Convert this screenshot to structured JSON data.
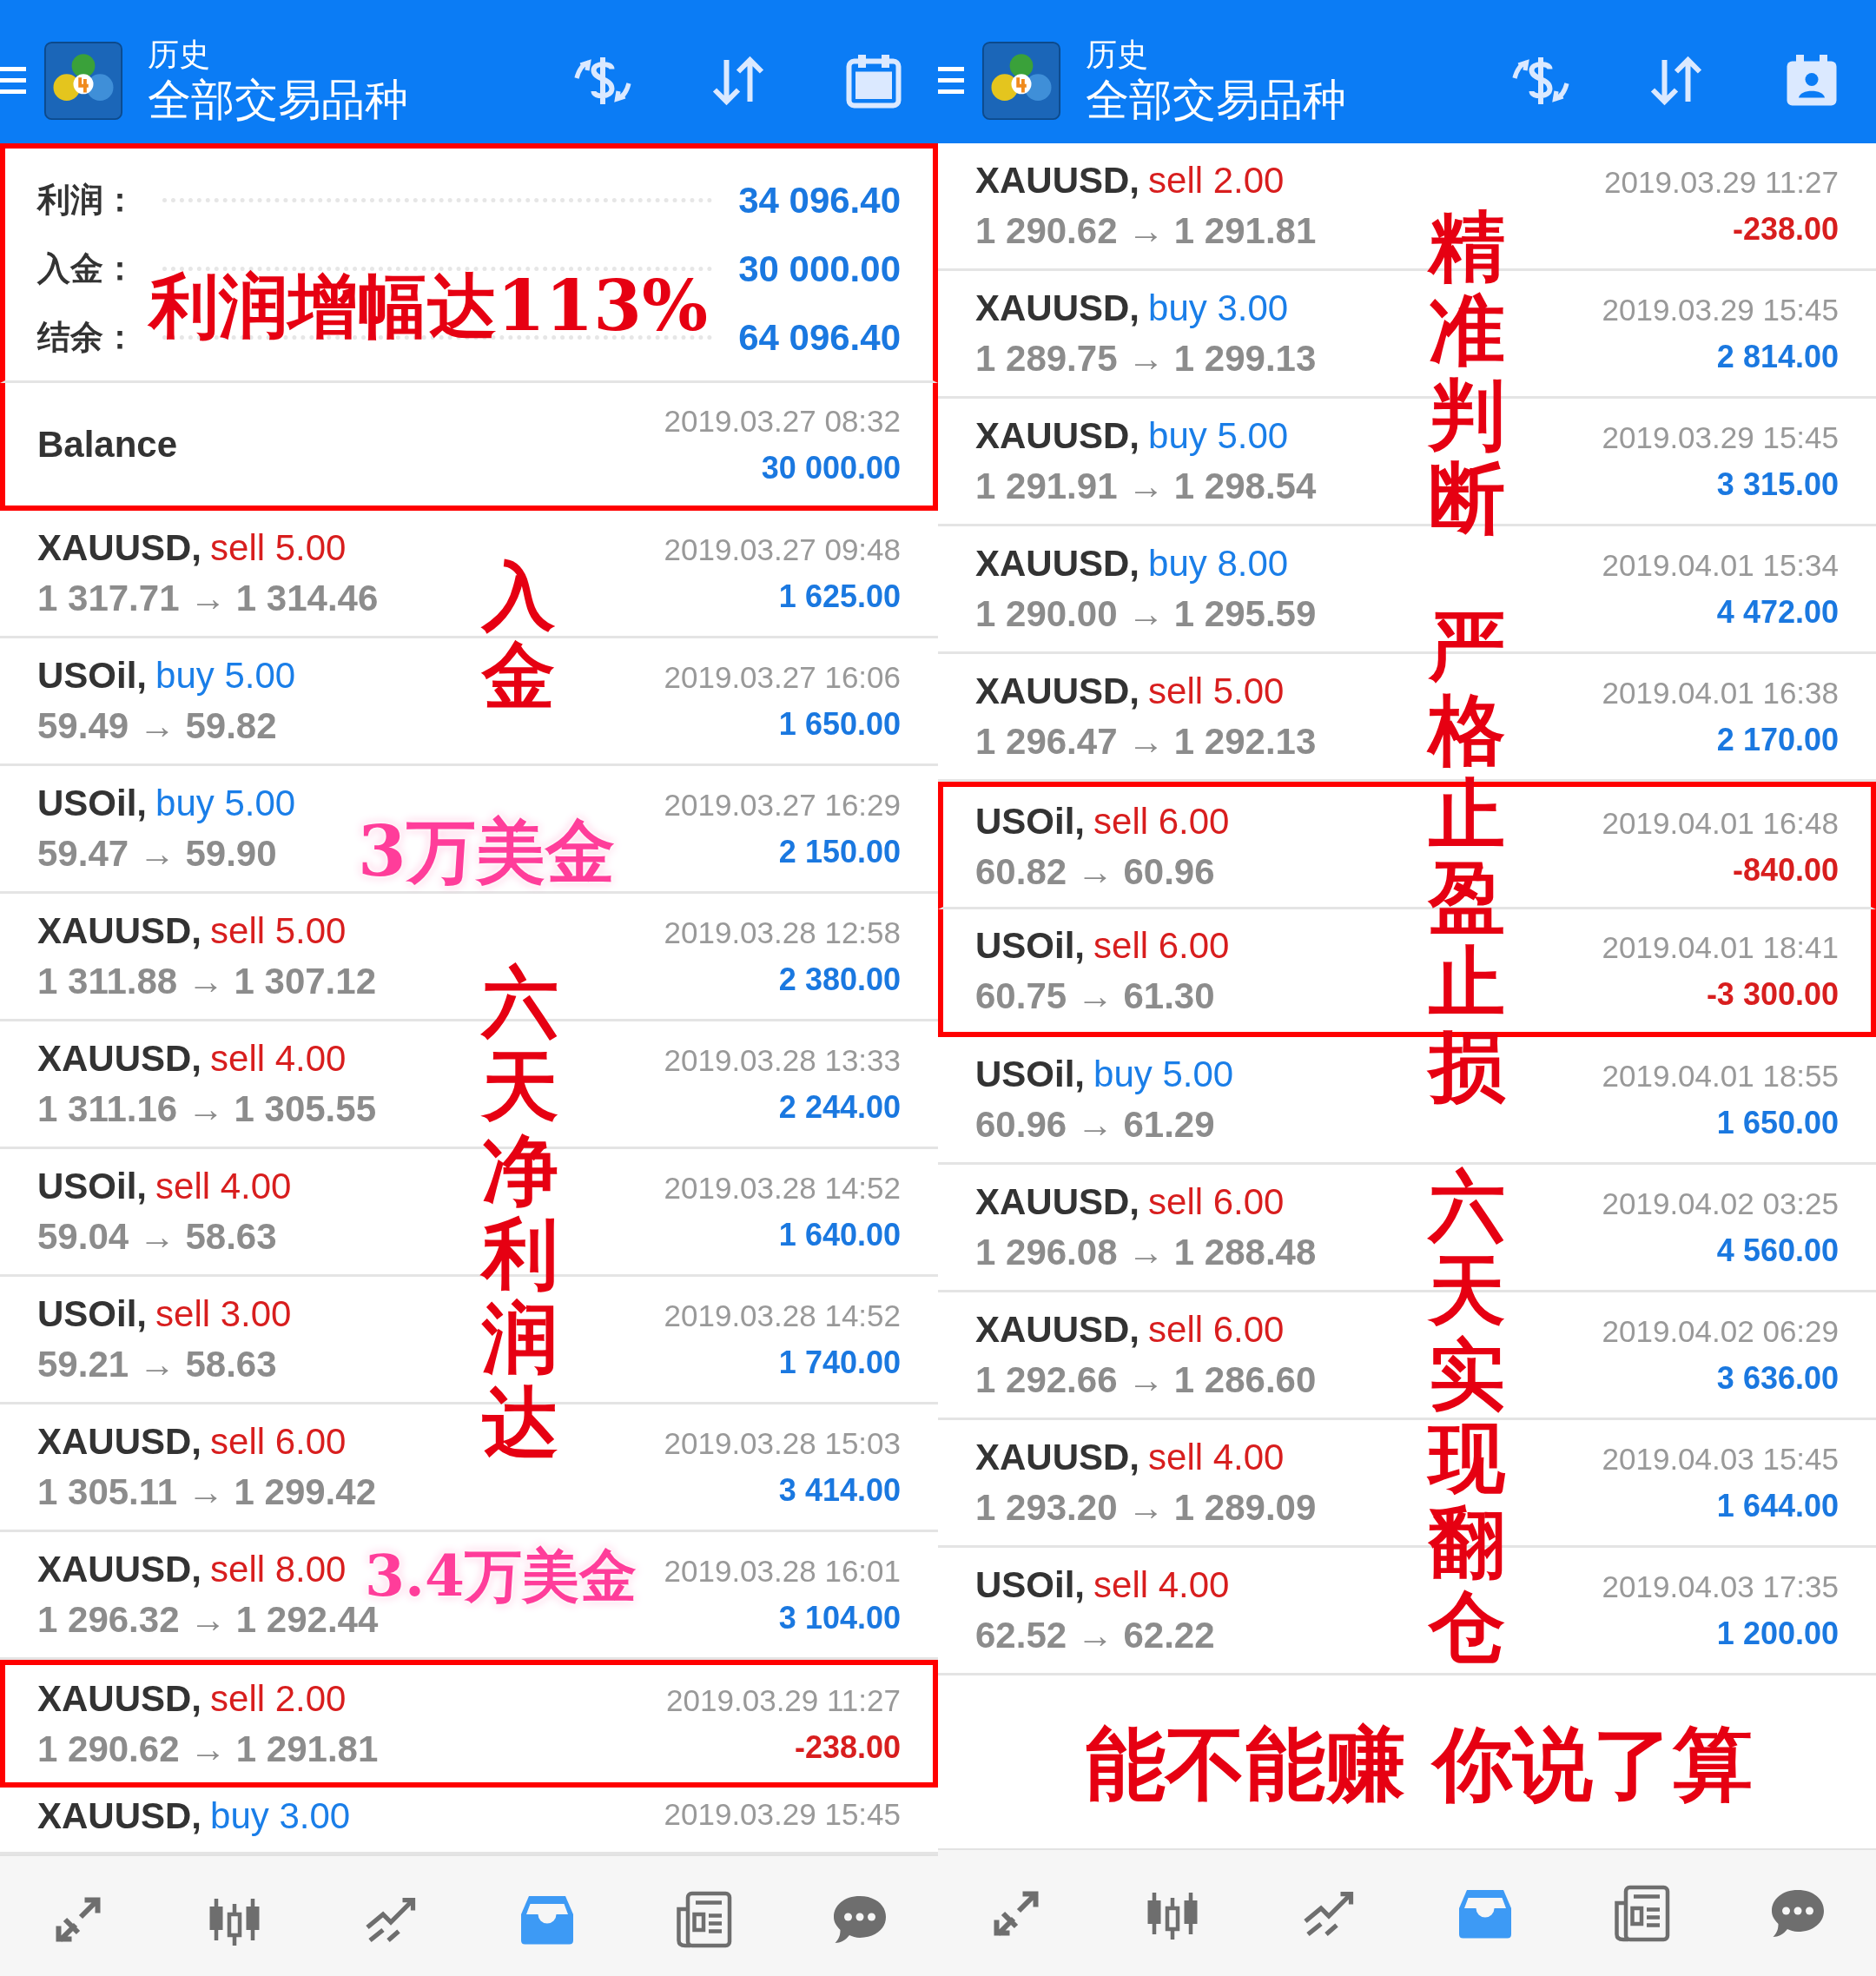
{
  "panels": [
    {
      "header": {
        "title": "历史",
        "subtitle": "全部交易品种"
      },
      "summary": {
        "highlighted": true,
        "lines": [
          {
            "label": "利润：",
            "value": "34 096.40"
          },
          {
            "label": "入金：",
            "value": "30 000.00"
          },
          {
            "label": "结余：",
            "value": "64 096.40"
          }
        ]
      },
      "balance": {
        "label": "Balance",
        "date": "2019.03.27 08:32",
        "amount": "30 000.00",
        "highlighted": true
      },
      "trades": [
        {
          "symbol": "XAUUSD,",
          "order": "sell 5.00",
          "kind": "sell",
          "prices": "1 317.71 → 1 314.46",
          "date": "2019.03.27 09:48",
          "profit": "1 625.00",
          "negative": false,
          "highlighted": false
        },
        {
          "symbol": "USOil,",
          "order": "buy 5.00",
          "kind": "buy",
          "prices": "59.49 → 59.82",
          "date": "2019.03.27 16:06",
          "profit": "1 650.00",
          "negative": false,
          "highlighted": false
        },
        {
          "symbol": "USOil,",
          "order": "buy 5.00",
          "kind": "buy",
          "prices": "59.47 → 59.90",
          "date": "2019.03.27 16:29",
          "profit": "2 150.00",
          "negative": false,
          "highlighted": false
        },
        {
          "symbol": "XAUUSD,",
          "order": "sell 5.00",
          "kind": "sell",
          "prices": "1 311.88 → 1 307.12",
          "date": "2019.03.28 12:58",
          "profit": "2 380.00",
          "negative": false,
          "highlighted": false
        },
        {
          "symbol": "XAUUSD,",
          "order": "sell 4.00",
          "kind": "sell",
          "prices": "1 311.16 → 1 305.55",
          "date": "2019.03.28 13:33",
          "profit": "2 244.00",
          "negative": false,
          "highlighted": false
        },
        {
          "symbol": "USOil,",
          "order": "sell 4.00",
          "kind": "sell",
          "prices": "59.04 → 58.63",
          "date": "2019.03.28 14:52",
          "profit": "1 640.00",
          "negative": false,
          "highlighted": false
        },
        {
          "symbol": "USOil,",
          "order": "sell 3.00",
          "kind": "sell",
          "prices": "59.21 → 58.63",
          "date": "2019.03.28 14:52",
          "profit": "1 740.00",
          "negative": false,
          "highlighted": false
        },
        {
          "symbol": "XAUUSD,",
          "order": "sell 6.00",
          "kind": "sell",
          "prices": "1 305.11 → 1 299.42",
          "date": "2019.03.28 15:03",
          "profit": "3 414.00",
          "negative": false,
          "highlighted": false
        },
        {
          "symbol": "XAUUSD,",
          "order": "sell 8.00",
          "kind": "sell",
          "prices": "1 296.32 → 1 292.44",
          "date": "2019.03.28 16:01",
          "profit": "3 104.00",
          "negative": false,
          "highlighted": false
        },
        {
          "symbol": "XAUUSD,",
          "order": "sell 2.00",
          "kind": "sell",
          "prices": "1 290.62 → 1 291.81",
          "date": "2019.03.29 11:27",
          "profit": "-238.00",
          "negative": true,
          "highlighted": true
        },
        {
          "symbol": "XAUUSD,",
          "order": "buy 3.00",
          "kind": "buy",
          "date": "2019.03.29 15:45",
          "partial": true,
          "highlighted": false
        }
      ],
      "annotations": [
        {
          "text": "利润增幅达113%",
          "kind": "horizontal",
          "color": "#e60012"
        },
        {
          "text": "入金",
          "kind": "vertical",
          "color": "#e60012"
        },
        {
          "text": "3万美金",
          "kind": "horizontal",
          "color": "#ff3d9a"
        },
        {
          "text": "六天净利润达",
          "kind": "vertical",
          "color": "#e60012"
        },
        {
          "text": "3.4万美金",
          "kind": "horizontal",
          "color": "#ff3d9a"
        }
      ],
      "nav": [
        {
          "selected": false
        },
        {
          "selected": false
        },
        {
          "selected": false
        },
        {
          "selected": true
        },
        {
          "selected": false
        },
        {
          "selected": false
        }
      ]
    },
    {
      "header": {
        "title": "历史",
        "subtitle": "全部交易品种"
      },
      "trades": [
        {
          "symbol": "XAUUSD,",
          "order": "sell 2.00",
          "kind": "sell",
          "prices": "1 290.62 → 1 291.81",
          "date": "2019.03.29 11:27",
          "profit": "-238.00",
          "negative": true,
          "highlighted": false
        },
        {
          "symbol": "XAUUSD,",
          "order": "buy 3.00",
          "kind": "buy",
          "prices": "1 289.75 → 1 299.13",
          "date": "2019.03.29 15:45",
          "profit": "2 814.00",
          "negative": false,
          "highlighted": false
        },
        {
          "symbol": "XAUUSD,",
          "order": "buy 5.00",
          "kind": "buy",
          "prices": "1 291.91 → 1 298.54",
          "date": "2019.03.29 15:45",
          "profit": "3 315.00",
          "negative": false,
          "highlighted": false
        },
        {
          "symbol": "XAUUSD,",
          "order": "buy 8.00",
          "kind": "buy",
          "prices": "1 290.00 → 1 295.59",
          "date": "2019.04.01 15:34",
          "profit": "4 472.00",
          "negative": false,
          "highlighted": false
        },
        {
          "symbol": "XAUUSD,",
          "order": "sell 5.00",
          "kind": "sell",
          "prices": "1 296.47 → 1 292.13",
          "date": "2019.04.01 16:38",
          "profit": "2 170.00",
          "negative": false,
          "highlighted": false
        },
        {
          "symbol": "USOil,",
          "order": "sell 6.00",
          "kind": "sell",
          "prices": "60.82 → 60.96",
          "date": "2019.04.01 16:48",
          "profit": "-840.00",
          "negative": true,
          "highlighted": true
        },
        {
          "symbol": "USOil,",
          "order": "sell 6.00",
          "kind": "sell",
          "prices": "60.75 → 61.30",
          "date": "2019.04.01 18:41",
          "profit": "-3 300.00",
          "negative": true,
          "highlighted": true
        },
        {
          "symbol": "USOil,",
          "order": "buy 5.00",
          "kind": "buy",
          "prices": "60.96 → 61.29",
          "date": "2019.04.01 18:55",
          "profit": "1 650.00",
          "negative": false,
          "highlighted": false
        },
        {
          "symbol": "XAUUSD,",
          "order": "sell 6.00",
          "kind": "sell",
          "prices": "1 296.08 → 1 288.48",
          "date": "2019.04.02 03:25",
          "profit": "4 560.00",
          "negative": false,
          "highlighted": false
        },
        {
          "symbol": "XAUUSD,",
          "order": "sell 6.00",
          "kind": "sell",
          "prices": "1 292.66 → 1 286.60",
          "date": "2019.04.02 06:29",
          "profit": "3 636.00",
          "negative": false,
          "highlighted": false
        },
        {
          "symbol": "XAUUSD,",
          "order": "sell 4.00",
          "kind": "sell",
          "prices": "1 293.20 → 1 289.09",
          "date": "2019.04.03 15:45",
          "profit": "1 644.00",
          "negative": false,
          "highlighted": false
        },
        {
          "symbol": "USOil,",
          "order": "sell 4.00",
          "kind": "sell",
          "prices": "62.52 → 62.22",
          "date": "2019.04.03 17:35",
          "profit": "1 200.00",
          "negative": false,
          "highlighted": false
        }
      ],
      "annotations": [
        {
          "text": "精准判断",
          "kind": "vertical",
          "color": "#e60012"
        },
        {
          "text": "严格止盈止损",
          "kind": "vertical",
          "color": "#e60012"
        },
        {
          "text": "六天实现翻仓",
          "kind": "vertical",
          "color": "#e60012"
        },
        {
          "text": "能不能赚 你说了算",
          "kind": "horizontal",
          "color": "#e60012"
        }
      ],
      "nav": [
        {
          "selected": false
        },
        {
          "selected": false
        },
        {
          "selected": false
        },
        {
          "selected": true
        },
        {
          "selected": false
        },
        {
          "selected": false
        }
      ]
    }
  ]
}
